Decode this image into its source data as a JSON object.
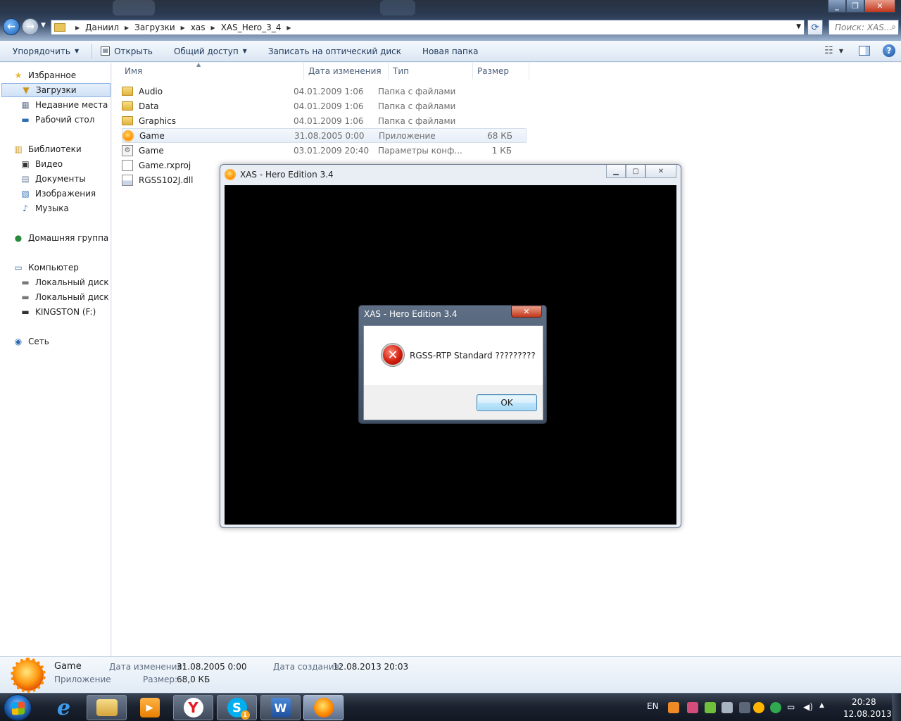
{
  "explorer": {
    "breadcrumb": [
      "Даниил",
      "Загрузки",
      "xas",
      "XAS_Hero_3_4"
    ],
    "search_placeholder": "Поиск: XAS...",
    "toolbar": {
      "organize": "Упорядочить",
      "open": "Открыть",
      "share": "Общий доступ",
      "burn": "Записать на оптический диск",
      "new_folder": "Новая папка"
    },
    "nav": {
      "favorites": "Избранное",
      "downloads": "Загрузки",
      "recent": "Недавние места",
      "desktop": "Рабочий стол",
      "libraries": "Библиотеки",
      "video": "Видео",
      "documents": "Документы",
      "pictures": "Изображения",
      "music": "Музыка",
      "homegroup": "Домашняя группа",
      "computer": "Компьютер",
      "disk_c": "Локальный диск (C",
      "disk_d": "Локальный диск (D",
      "kingston": "KINGSTON (F:)",
      "network": "Сеть"
    },
    "columns": {
      "name": "Имя",
      "modified": "Дата изменения",
      "type": "Тип",
      "size": "Размер"
    },
    "files": [
      {
        "name": "Audio",
        "modified": "04.01.2009 1:06",
        "type": "Папка с файлами",
        "size": "",
        "icon": "folder-icon"
      },
      {
        "name": "Data",
        "modified": "04.01.2009 1:06",
        "type": "Папка с файлами",
        "size": "",
        "icon": "folder-icon"
      },
      {
        "name": "Graphics",
        "modified": "04.01.2009 1:06",
        "type": "Папка с файлами",
        "size": "",
        "icon": "folder-icon"
      },
      {
        "name": "Game",
        "modified": "31.08.2005 0:00",
        "type": "Приложение",
        "size": "68 КБ",
        "icon": "app-icon"
      },
      {
        "name": "Game",
        "modified": "03.01.2009 20:40",
        "type": "Параметры конф...",
        "size": "1 КБ",
        "icon": "config-file-icon"
      },
      {
        "name": "Game.rxproj",
        "modified": "",
        "type": "",
        "size": "",
        "icon": "document-icon"
      },
      {
        "name": "RGSS102J.dll",
        "modified": "",
        "type": "",
        "size": "",
        "icon": "dll-file-icon"
      }
    ],
    "details": {
      "name": "Game",
      "kind": "Приложение",
      "modified_label": "Дата изменения:",
      "modified_value": "31.08.2005 0:00",
      "size_label": "Размер:",
      "size_value": "68,0 КБ",
      "created_label": "Дата создания:",
      "created_value": "12.08.2013 20:03"
    }
  },
  "game_window": {
    "title": "XAS - Hero Edition 3.4"
  },
  "dialog": {
    "title": "XAS - Hero Edition 3.4",
    "message": "RGSS-RTP Standard ?????????",
    "ok": "OK"
  },
  "taskbar": {
    "language": "EN",
    "time": "20:28",
    "date": "12.08.2013",
    "skype_badge": "1",
    "apps": [
      "internet-explorer-icon",
      "file-explorer-icon",
      "media-player-icon",
      "yandex-browser-icon",
      "skype-icon",
      "word-icon",
      "game-icon"
    ]
  },
  "colors": {
    "accent": "#2f7bd2",
    "error_red": "#d41f0e",
    "game_orange": "#ff8a00"
  }
}
